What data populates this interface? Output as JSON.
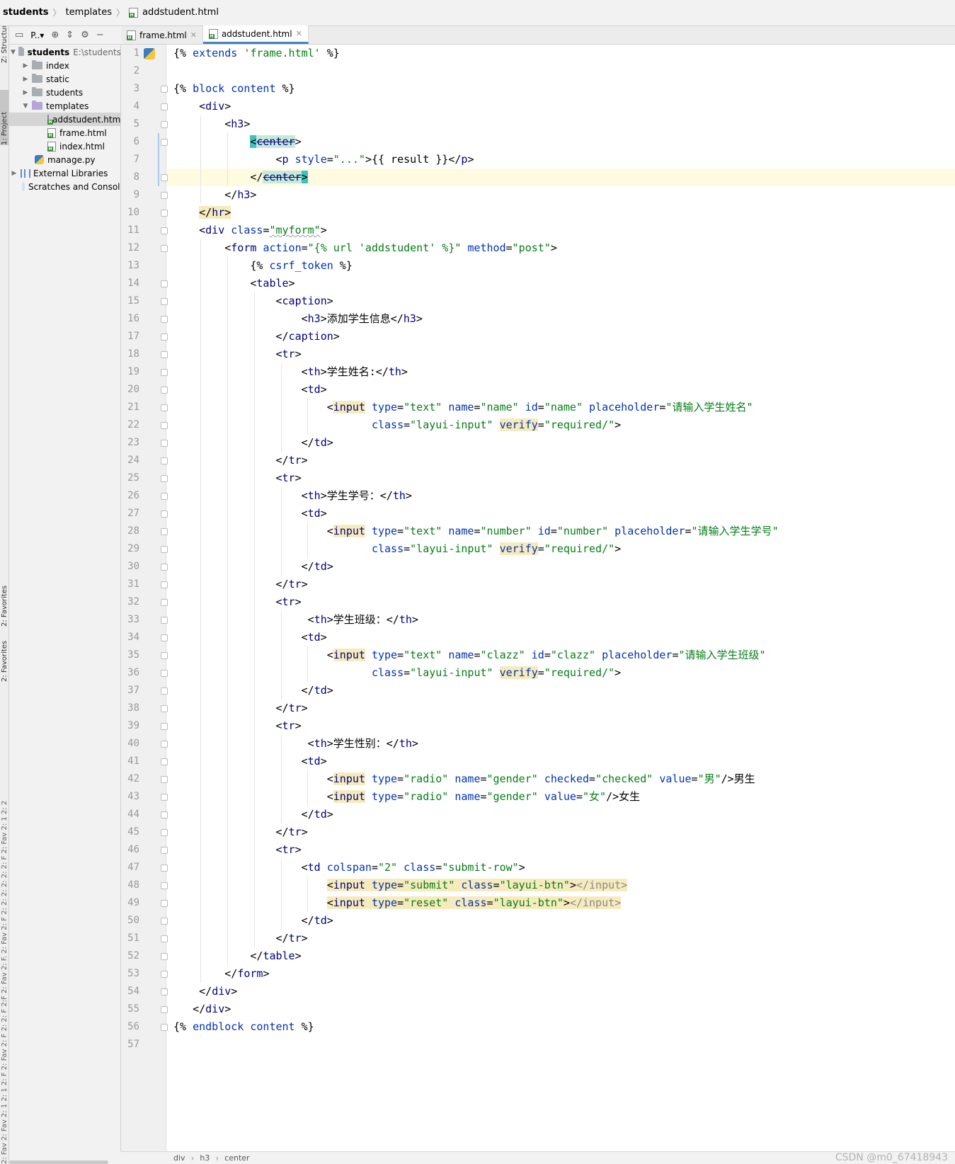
{
  "navbar": {
    "crumbs": [
      "students",
      "templates",
      "addstudent.html"
    ]
  },
  "side_tabs": {
    "structure": "Z: Structure",
    "project": "1: Project",
    "favorites": "2: Favorites",
    "favorites_b": "2: Favorites",
    "noise": "2: Fav 2: Fav 2: 1 2: 1 2: F 2: Fav 2: F 2: 2: F 2:F 2: Fav 2: F. 2: Fav 2: F 2: 2: 2: 2: 2: 2: F 2: Fav 2: 1 2: 2"
  },
  "project_panel": {
    "toolbar_label": "P..▾",
    "tree": [
      {
        "label": "students",
        "hint": "E:\\students",
        "kind": "root-folder"
      },
      {
        "label": "index",
        "kind": "folder"
      },
      {
        "label": "static",
        "kind": "folder"
      },
      {
        "label": "students",
        "kind": "folder"
      },
      {
        "label": "templates",
        "kind": "purple-folder"
      },
      {
        "label": "addstudent.html",
        "kind": "html"
      },
      {
        "label": "frame.html",
        "kind": "html"
      },
      {
        "label": "index.html",
        "kind": "html"
      },
      {
        "label": "manage.py",
        "kind": "py"
      },
      {
        "label": "External Libraries",
        "kind": "lib"
      },
      {
        "label": "Scratches and Consoles",
        "kind": "scratch"
      }
    ]
  },
  "tabs": [
    {
      "label": "frame.html",
      "active": false
    },
    {
      "label": "addstudent.html",
      "active": true
    }
  ],
  "editor": {
    "current_line": 8,
    "line_count": 57,
    "lines": [
      "{% extends 'frame.html' %}",
      "",
      "{% block content %}",
      "    <div>",
      "        <h3>",
      "            <center>",
      "                <p style=\"...\">{{ result }}</p>",
      "            </center>",
      "        </h3>",
      "    </hr>",
      "    <div class=\"myform\">",
      "        <form action=\"{% url 'addstudent' %}\" method=\"post\">",
      "            {% csrf_token %}",
      "            <table>",
      "                <caption>",
      "                    <h3>添加学生信息</h3>",
      "                </caption>",
      "                <tr>",
      "                    <th>学生姓名:</th>",
      "                    <td>",
      "                        <input type=\"text\" name=\"name\" id=\"name\" placeholder=\"请输入学生姓名\"",
      "                               class=\"layui-input\" verify=\"required/\">",
      "                    </td>",
      "                </tr>",
      "                <tr>",
      "                    <th>学生学号：</th>",
      "                    <td>",
      "                        <input type=\"text\" name=\"number\" id=\"number\" placeholder=\"请输入学生学号\"",
      "                               class=\"layui-input\" verify=\"required/\">",
      "                    </td>",
      "                </tr>",
      "                <tr>",
      "                     <th>学生班级：</th>",
      "                    <td>",
      "                        <input type=\"text\" name=\"clazz\" id=\"clazz\" placeholder=\"请输入学生班级\"",
      "                               class=\"layui-input\" verify=\"required/\">",
      "                    </td>",
      "                </tr>",
      "                <tr>",
      "                     <th>学生性别：</th>",
      "                    <td>",
      "                        <input type=\"radio\" name=\"gender\" checked=\"checked\" value=\"男\"/>男生",
      "                        <input type=\"radio\" name=\"gender\" value=\"女\"/>女生",
      "                    </td>",
      "                </tr>",
      "                <tr>",
      "                    <td colspan=\"2\" class=\"submit-row\">",
      "                        <input type=\"submit\" class=\"layui-btn\"></input>",
      "                        <input type=\"reset\" class=\"layui-btn\"></input>",
      "                    </td>",
      "                </tr>",
      "            </table>",
      "        </form>",
      "    </div>",
      "   </div>",
      "{% endblock content %}",
      ""
    ]
  },
  "status_breadcrumb": [
    "div",
    "h3",
    "center"
  ],
  "watermark": "CSDN @m0_67418943",
  "colors": {
    "tag": "#000080",
    "attribute": "#0033b3",
    "string": "#067d17",
    "highlight": "#f6ebbc",
    "caret_line": "#fffbe0",
    "tab_accent": "#4083c9"
  }
}
